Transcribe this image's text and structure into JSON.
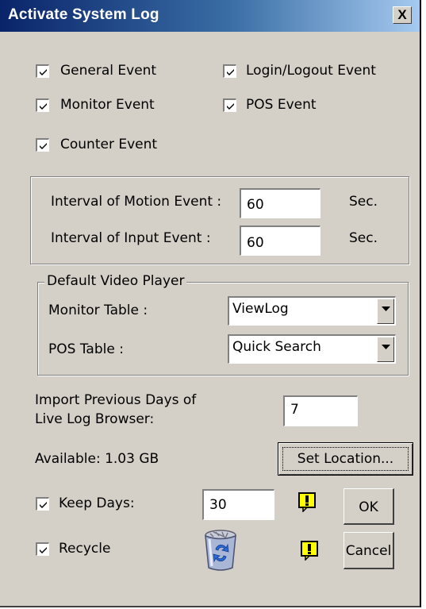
{
  "window": {
    "title": "Activate System Log",
    "close_glyph": "X"
  },
  "events": {
    "general": {
      "label": "General Event",
      "checked": true
    },
    "login_logout": {
      "label": "Login/Logout Event",
      "checked": true
    },
    "monitor": {
      "label": "Monitor Event",
      "checked": true
    },
    "pos": {
      "label": "POS Event",
      "checked": true
    },
    "counter": {
      "label": "Counter Event",
      "checked": true
    }
  },
  "intervals": {
    "motion": {
      "label": "Interval of Motion Event :",
      "value": "60",
      "unit": "Sec."
    },
    "input": {
      "label": "Interval of Input Event :",
      "value": "60",
      "unit": "Sec."
    }
  },
  "video_player": {
    "legend": "Default Video Player",
    "monitor_table": {
      "label": "Monitor Table :",
      "value": "ViewLog"
    },
    "pos_table": {
      "label": "POS Table :",
      "value": "Quick Search"
    }
  },
  "import": {
    "label_line1": "Import Previous Days of",
    "label_line2": "Live Log Browser:",
    "value": "7"
  },
  "storage": {
    "available": "Available: 1.03 GB",
    "set_location_label": "Set Location..."
  },
  "keep_days": {
    "label": "Keep Days:",
    "checked": true,
    "value": "30"
  },
  "recycle": {
    "label": "Recycle",
    "checked": true
  },
  "buttons": {
    "ok": "OK",
    "cancel": "Cancel"
  },
  "icons": {
    "check": "check-mark-icon",
    "warning": "warning-exclamation-icon",
    "recycle": "recycle-bin-icon",
    "dropdown": "chevron-down-icon"
  },
  "colors": {
    "titlebar_start": "#0a246a",
    "titlebar_end": "#a6caf0",
    "dialog_bg": "#d4d0c8",
    "warning_yellow": "#ffff00"
  }
}
